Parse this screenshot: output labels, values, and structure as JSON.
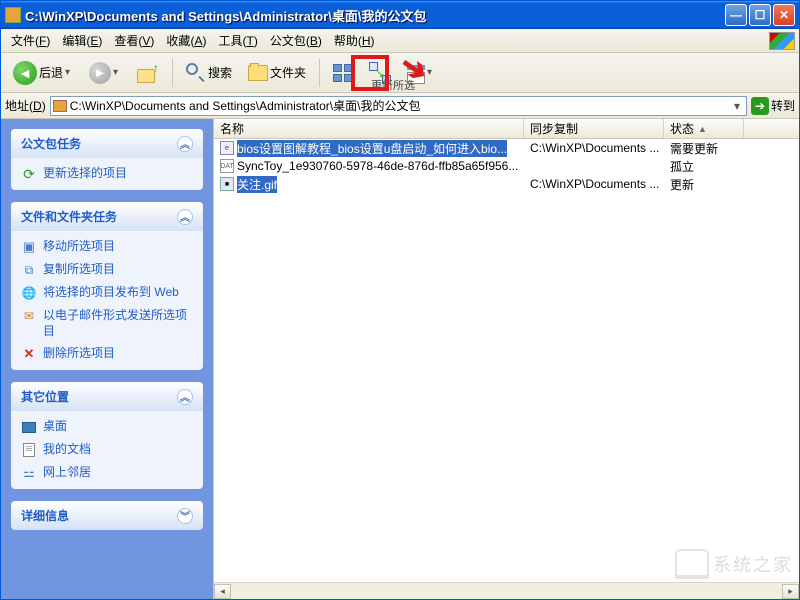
{
  "window": {
    "title": "C:\\WinXP\\Documents and Settings\\Administrator\\桌面\\我的公文包"
  },
  "menu": {
    "file": {
      "label": "文件",
      "key": "F"
    },
    "edit": {
      "label": "编辑",
      "key": "E"
    },
    "view": {
      "label": "查看",
      "key": "V"
    },
    "fav": {
      "label": "收藏",
      "key": "A"
    },
    "tools": {
      "label": "工具",
      "key": "T"
    },
    "brief": {
      "label": "公文包",
      "key": "B"
    },
    "help": {
      "label": "帮助",
      "key": "H"
    }
  },
  "toolbar": {
    "back": "后退",
    "search": "搜索",
    "folders": "文件夹",
    "update_label": "更新所选"
  },
  "address": {
    "label": "地址",
    "key": "D",
    "path": "C:\\WinXP\\Documents and Settings\\Administrator\\桌面\\我的公文包",
    "go": "转到"
  },
  "sidebar": {
    "brief": {
      "title": "公文包任务",
      "items": [
        {
          "label": "更新选择的项目"
        }
      ]
    },
    "filetasks": {
      "title": "文件和文件夹任务",
      "items": [
        {
          "label": "移动所选项目"
        },
        {
          "label": "复制所选项目"
        },
        {
          "label": "将选择的项目发布到 Web"
        },
        {
          "label": "以电子邮件形式发送所选项目"
        },
        {
          "label": "删除所选项目"
        }
      ]
    },
    "places": {
      "title": "其它位置",
      "items": [
        {
          "label": "桌面"
        },
        {
          "label": "我的文档"
        },
        {
          "label": "网上邻居"
        }
      ]
    },
    "details": {
      "title": "详细信息"
    }
  },
  "columns": {
    "name": "名称",
    "sync": "同步复制",
    "status": "状态"
  },
  "rows": [
    {
      "name": "bios设置图解教程_bios设置u盘启动_如何进入bio...",
      "sync": "C:\\WinXP\\Documents ...",
      "status": "需要更新",
      "icon": "html",
      "selected": true
    },
    {
      "name": "SyncToy_1e930760-5978-46de-876d-ffb85a65f956...",
      "sync": "",
      "status": "孤立",
      "icon": "dat",
      "selected": false
    },
    {
      "name": "关注.gif",
      "sync": "C:\\WinXP\\Documents ...",
      "status": "更新",
      "icon": "gif",
      "selected": true
    }
  ],
  "watermark": "系统之家"
}
